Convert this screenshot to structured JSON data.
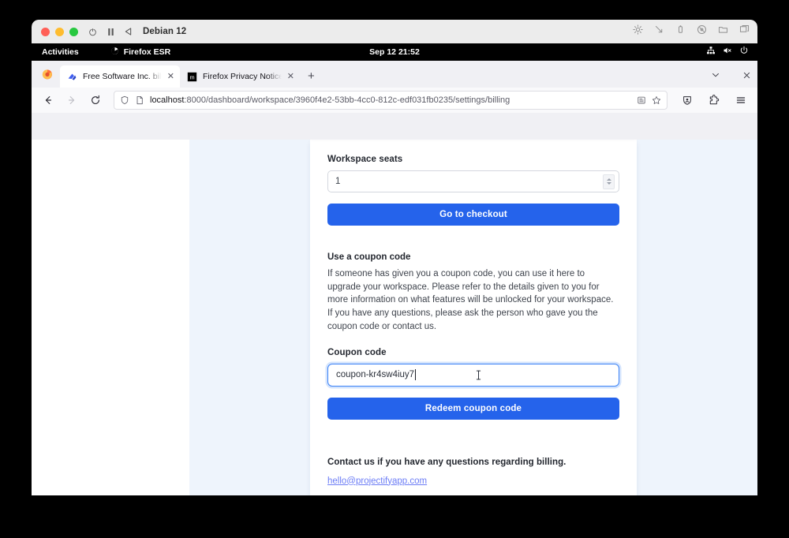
{
  "vm": {
    "title": "Debian 12",
    "controls": [
      "power-icon",
      "pause-icon",
      "send-key-icon"
    ],
    "toolbar_icons": [
      "brightness-icon",
      "resize-icon",
      "usb-icon",
      "disc-icon",
      "folder-icon",
      "windows-icon"
    ]
  },
  "desktop": {
    "activities": "Activities",
    "app_name": "Firefox ESR",
    "clock": "Sep 12  21:52",
    "status_icons": [
      "network-icon",
      "volume-muted-icon",
      "power-icon"
    ]
  },
  "browser": {
    "tabs": [
      {
        "title": "Free Software Inc. billing",
        "favicon": "projectify-icon",
        "active": true
      },
      {
        "title": "Firefox Privacy Notice — …",
        "favicon": "mozilla-icon",
        "active": false
      }
    ],
    "new_tab_label": "+",
    "nav": {
      "back": "←",
      "forward": "→",
      "reload": "⟳"
    },
    "url": {
      "host": "localhost",
      "path": ":8000/dashboard/workspace/3960f4e2-53bb-4cc0-812c-edf031fb0235/settings/billing"
    },
    "urlbar_icons": [
      "shield-icon",
      "page-icon",
      "reader-view-icon",
      "bookmark-star-icon"
    ],
    "toolbar_icons": [
      "account-shield-icon",
      "extensions-icon",
      "app-menu-icon"
    ],
    "tabstrip_icons": [
      "list-all-tabs-icon",
      "close-window-icon"
    ]
  },
  "page": {
    "seats": {
      "label": "Workspace seats",
      "value": "1",
      "checkout_button": "Go to checkout"
    },
    "coupon": {
      "heading": "Use a coupon code",
      "description": "If someone has given you a coupon code, you can use it here to upgrade your workspace. Please refer to the details given to you for more information on what features will be unlocked for your workspace. If you have any questions, please ask the person who gave you the coupon code or contact us.",
      "code_label": "Coupon code",
      "code_value": "coupon-kr4sw4iuy7",
      "redeem_button": "Redeem coupon code"
    },
    "contact": {
      "text": "Contact us if you have any questions regarding billing.",
      "email": "hello@projectifyapp.com"
    }
  },
  "colors": {
    "primary_blue": "#2563eb",
    "focus_ring": "#3b82f6",
    "page_blue_bg": "#eef4fc",
    "link_blue": "#6b7cf6"
  }
}
